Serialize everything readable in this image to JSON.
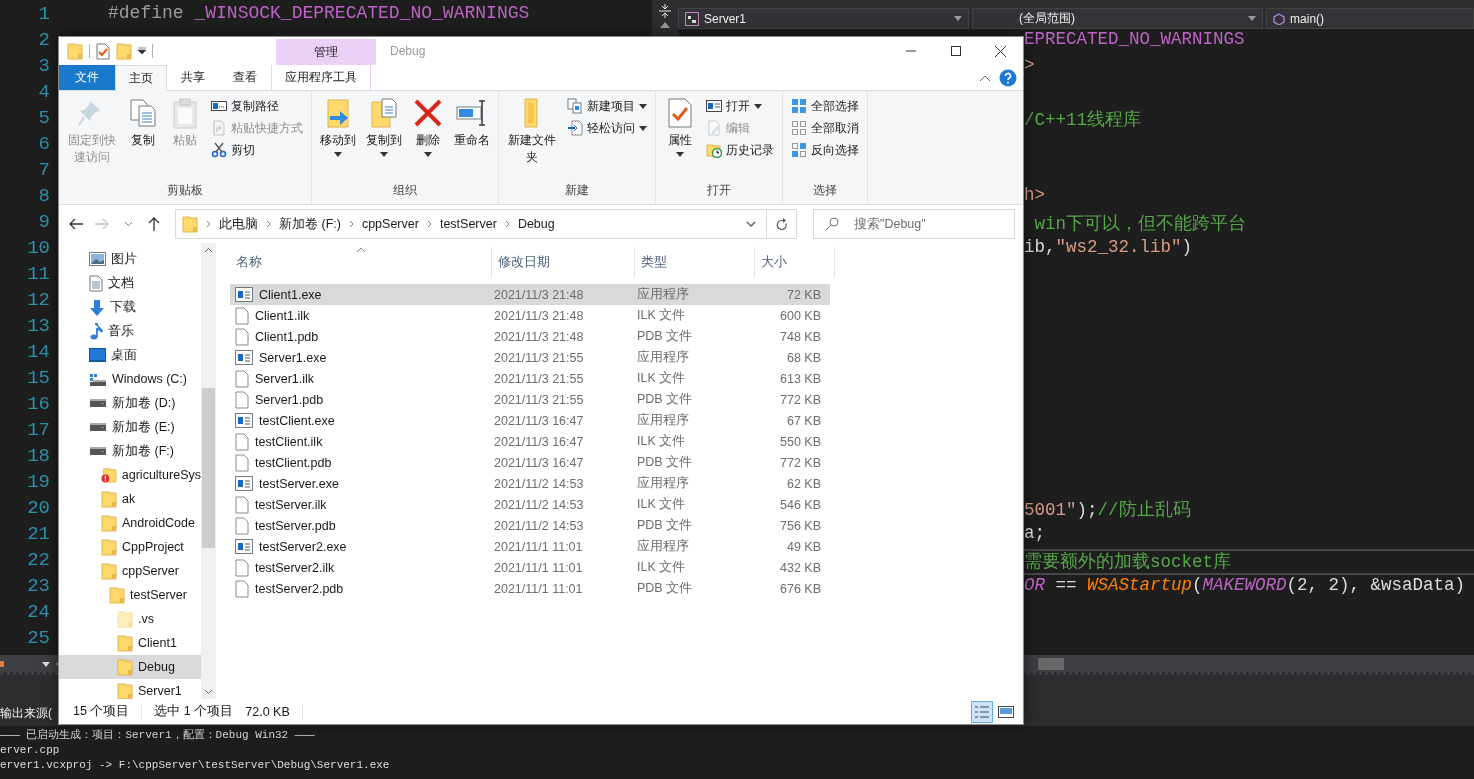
{
  "ide": {
    "left_editor": {
      "line_numbers": [
        "1",
        "2",
        "3",
        "4",
        "5",
        "6",
        "7",
        "8",
        "9",
        "10",
        "11",
        "12",
        "13",
        "14",
        "15",
        "16",
        "17",
        "18",
        "19",
        "20",
        "21",
        "22",
        "23",
        "24",
        "25"
      ],
      "lines": [
        {
          "tokens": [
            {
              "text": "#define",
              "kind": "directive"
            },
            {
              "text": " _WINSOCK_DEPRECATED_NO_WARNINGS",
              "kind": "macro"
            }
          ]
        }
      ]
    },
    "right_editor": {
      "nav": [
        {
          "text": "Server1",
          "kind": "project"
        },
        {
          "text": "(全局范围)",
          "kind": "scope"
        },
        {
          "text": "main()",
          "kind": "member"
        }
      ],
      "rows": [
        {
          "tokens": [
            {
              "text": "EPRECATED_NO_WARNINGS",
              "kind": "macro"
            }
          ],
          "current": false
        },
        {
          "tokens": [
            {
              "text": ">",
              "kind": "string"
            }
          ],
          "current": false
        },
        {
          "current": false
        },
        {
          "tokens": [
            {
              "text": "/C++11线程库",
              "kind": "comment"
            }
          ],
          "current": false
        },
        {
          "current": false
        },
        {
          "current": false
        },
        {
          "tokens": [
            {
              "text": "h>",
              "kind": "string"
            }
          ],
          "current": false
        },
        {
          "tokens": [
            {
              "text": " win下可以，但不能跨平台",
              "kind": "comment"
            }
          ],
          "current": false
        },
        {
          "tokens": [
            {
              "text": "ib,",
              "kind": "plain"
            },
            {
              "text": "\"ws2_32.lib\"",
              "kind": "string"
            },
            {
              "text": ")",
              "kind": "plain"
            }
          ],
          "current": false
        },
        {
          "current": false
        },
        {
          "current": false
        },
        {
          "current": false
        },
        {
          "current": false
        },
        {
          "current": false
        },
        {
          "current": false
        },
        {
          "current": false
        },
        {
          "current": false
        },
        {
          "current": false
        },
        {
          "tokens": [
            {
              "text": "5001\"",
              "kind": "string"
            },
            {
              "text": ");",
              "kind": "plain"
            },
            {
              "text": "//防止乱码",
              "kind": "comment"
            }
          ],
          "current": false
        },
        {
          "tokens": [
            {
              "text": "a;",
              "kind": "plain"
            }
          ],
          "current": false
        },
        {
          "tokens": [
            {
              "text": "需要额外的加载socket库",
              "kind": "comment"
            }
          ],
          "current": true
        },
        {
          "tokens": [
            {
              "text": "OR",
              "kind": "macrocall"
            },
            {
              "text": " == ",
              "kind": "plain"
            },
            {
              "text": "WSAStartup",
              "kind": "func"
            },
            {
              "text": "(",
              "kind": "plain"
            },
            {
              "text": "MAKEWORD",
              "kind": "macrocall"
            },
            {
              "text": "(2, 2), &wsaData)",
              "kind": "plain"
            }
          ],
          "current": false
        }
      ]
    },
    "output": {
      "source_label": "输出来源(",
      "lines": [
        "——— 已启动生成：项目：Server1，配置：Debug Win32 ———",
        "erver.cpp",
        "erver1.vcxproj -> F:\\cppServer\\testServer\\Debug\\Server1.exe"
      ]
    }
  },
  "explorer": {
    "context_header": "管理",
    "title": "Debug",
    "tabs": [
      {
        "label": "文件",
        "kind": "file",
        "selected": false
      },
      {
        "label": "主页",
        "kind": "normal",
        "selected": true
      },
      {
        "label": "共享",
        "kind": "normal",
        "selected": false
      },
      {
        "label": "查看",
        "kind": "normal",
        "selected": false
      },
      {
        "label": "应用程序工具",
        "kind": "context",
        "selected": false
      }
    ],
    "ribbon_groups": [
      {
        "label": "剪贴板",
        "items": [
          {
            "label": "固定到快速访问",
            "kind": "large",
            "disabled": true,
            "dropdown": false
          },
          {
            "label": "复制",
            "kind": "large",
            "disabled": false,
            "dropdown": false
          },
          {
            "label": "粘贴",
            "kind": "large",
            "disabled": true,
            "dropdown": false
          },
          {
            "label": "复制路径",
            "kind": "small",
            "disabled": false,
            "dropdown": false
          },
          {
            "label": "粘贴快捷方式",
            "kind": "small",
            "disabled": true,
            "dropdown": false
          },
          {
            "label": "剪切",
            "kind": "small",
            "disabled": false,
            "dropdown": false
          }
        ]
      },
      {
        "label": "组织",
        "items": [
          {
            "label": "移动到",
            "kind": "large",
            "disabled": false,
            "dropdown": true
          },
          {
            "label": "复制到",
            "kind": "large",
            "disabled": false,
            "dropdown": true
          },
          {
            "label": "删除",
            "kind": "large",
            "disabled": false,
            "dropdown": true
          },
          {
            "label": "重命名",
            "kind": "large",
            "disabled": false,
            "dropdown": false
          }
        ]
      },
      {
        "label": "新建",
        "items": [
          {
            "label": "新建文件夹",
            "kind": "large",
            "disabled": false,
            "dropdown": false
          },
          {
            "label": "新建项目",
            "kind": "small",
            "disabled": false,
            "dropdown": true
          },
          {
            "label": "轻松访问",
            "kind": "small",
            "disabled": false,
            "dropdown": true
          }
        ]
      },
      {
        "label": "打开",
        "items": [
          {
            "label": "属性",
            "kind": "large",
            "disabled": false,
            "dropdown": true
          },
          {
            "label": "打开",
            "kind": "small",
            "disabled": false,
            "dropdown": true
          },
          {
            "label": "编辑",
            "kind": "small",
            "disabled": true,
            "dropdown": false
          },
          {
            "label": "历史记录",
            "kind": "small",
            "disabled": false,
            "dropdown": false
          }
        ]
      },
      {
        "label": "选择",
        "items": [
          {
            "label": "全部选择",
            "kind": "small",
            "disabled": false,
            "dropdown": false
          },
          {
            "label": "全部取消",
            "kind": "small",
            "disabled": false,
            "dropdown": false
          },
          {
            "label": "反向选择",
            "kind": "small",
            "disabled": false,
            "dropdown": false
          }
        ]
      }
    ],
    "navigation": [
      {
        "kind": "back",
        "disabled": false
      },
      {
        "kind": "forward",
        "disabled": true
      },
      {
        "kind": "recent",
        "disabled": false
      },
      {
        "kind": "up",
        "disabled": false
      }
    ],
    "address": {
      "crumbs": [
        "此电脑",
        "新加卷 (F:)",
        "cppServer",
        "testServer",
        "Debug"
      ]
    },
    "search": {
      "placeholder": "搜索\"Debug\""
    },
    "tree": [
      {
        "label": "图片",
        "kind": "pictures",
        "selected": false
      },
      {
        "label": "文档",
        "kind": "documents",
        "selected": false
      },
      {
        "label": "下载",
        "kind": "downloads",
        "selected": false
      },
      {
        "label": "音乐",
        "kind": "music",
        "selected": false
      },
      {
        "label": "桌面",
        "kind": "desktop",
        "selected": false
      },
      {
        "label": "Windows (C:)",
        "kind": "sysdrive",
        "selected": false
      },
      {
        "label": "新加卷 (D:)",
        "kind": "drive",
        "selected": false
      },
      {
        "label": "新加卷 (E:)",
        "kind": "drive",
        "selected": false
      },
      {
        "label": "新加卷 (F:)",
        "kind": "drive",
        "selected": false,
        "children": [
          {
            "label": "agricultureSys",
            "kind": "flagged",
            "selected": false
          },
          {
            "label": "ak",
            "kind": "folder",
            "selected": false
          },
          {
            "label": "AndroidCode",
            "kind": "folder",
            "selected": false
          },
          {
            "label": "CppProject",
            "kind": "folder",
            "selected": false
          },
          {
            "label": "cppServer",
            "kind": "folder",
            "selected": false,
            "children": [
              {
                "label": "testServer",
                "kind": "folder",
                "selected": false,
                "children": [
                  {
                    "label": ".vs",
                    "kind": "hidden",
                    "selected": false
                  },
                  {
                    "label": "Client1",
                    "kind": "folder",
                    "selected": false
                  },
                  {
                    "label": "Debug",
                    "kind": "folder",
                    "selected": true
                  },
                  {
                    "label": "Server1",
                    "kind": "folder",
                    "selected": false
                  }
                ]
              }
            ]
          }
        ]
      }
    ],
    "columns": [
      {
        "label": "名称",
        "sorted": true
      },
      {
        "label": "修改日期",
        "sorted": false
      },
      {
        "label": "类型",
        "sorted": false
      },
      {
        "label": "大小",
        "sorted": false
      }
    ],
    "files": [
      {
        "name": "Client1.exe",
        "modified": "2021/11/3 21:48",
        "type": "应用程序",
        "size": "72 KB",
        "kind": "exe",
        "selected": true
      },
      {
        "name": "Client1.ilk",
        "modified": "2021/11/3 21:48",
        "type": "ILK 文件",
        "size": "600 KB",
        "kind": "file",
        "selected": false
      },
      {
        "name": "Client1.pdb",
        "modified": "2021/11/3 21:48",
        "type": "PDB 文件",
        "size": "748 KB",
        "kind": "file",
        "selected": false
      },
      {
        "name": "Server1.exe",
        "modified": "2021/11/3 21:55",
        "type": "应用程序",
        "size": "68 KB",
        "kind": "exe",
        "selected": false
      },
      {
        "name": "Server1.ilk",
        "modified": "2021/11/3 21:55",
        "type": "ILK 文件",
        "size": "613 KB",
        "kind": "file",
        "selected": false
      },
      {
        "name": "Server1.pdb",
        "modified": "2021/11/3 21:55",
        "type": "PDB 文件",
        "size": "772 KB",
        "kind": "file",
        "selected": false
      },
      {
        "name": "testClient.exe",
        "modified": "2021/11/3 16:47",
        "type": "应用程序",
        "size": "67 KB",
        "kind": "exe",
        "selected": false
      },
      {
        "name": "testClient.ilk",
        "modified": "2021/11/3 16:47",
        "type": "ILK 文件",
        "size": "550 KB",
        "kind": "file",
        "selected": false
      },
      {
        "name": "testClient.pdb",
        "modified": "2021/11/3 16:47",
        "type": "PDB 文件",
        "size": "772 KB",
        "kind": "file",
        "selected": false
      },
      {
        "name": "testServer.exe",
        "modified": "2021/11/2 14:53",
        "type": "应用程序",
        "size": "62 KB",
        "kind": "exe",
        "selected": false
      },
      {
        "name": "testServer.ilk",
        "modified": "2021/11/2 14:53",
        "type": "ILK 文件",
        "size": "546 KB",
        "kind": "file",
        "selected": false
      },
      {
        "name": "testServer.pdb",
        "modified": "2021/11/2 14:53",
        "type": "PDB 文件",
        "size": "756 KB",
        "kind": "file",
        "selected": false
      },
      {
        "name": "testServer2.exe",
        "modified": "2021/11/1 11:01",
        "type": "应用程序",
        "size": "49 KB",
        "kind": "exe",
        "selected": false
      },
      {
        "name": "testServer2.ilk",
        "modified": "2021/11/1 11:01",
        "type": "ILK 文件",
        "size": "432 KB",
        "kind": "file",
        "selected": false
      },
      {
        "name": "testServer2.pdb",
        "modified": "2021/11/1 11:01",
        "type": "PDB 文件",
        "size": "676 KB",
        "kind": "file",
        "selected": false
      }
    ],
    "status": {
      "count": "15 个项目",
      "selection": "选中 1 个项目",
      "selection_size": "72.0 KB"
    },
    "views": [
      {
        "kind": "details",
        "selected": true
      },
      {
        "kind": "thumbnails",
        "selected": false
      }
    ]
  }
}
